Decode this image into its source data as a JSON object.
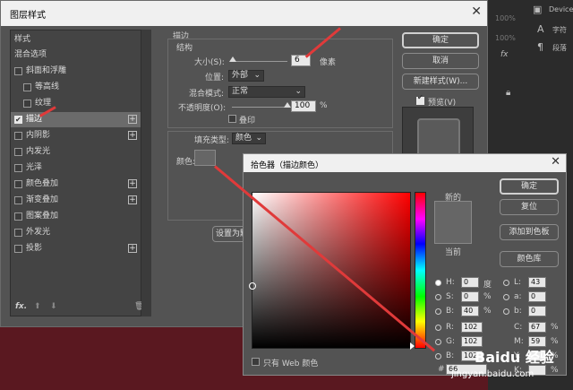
{
  "layer_style": {
    "title": "图层样式",
    "styles_header": "样式",
    "blend_options": "混合选项",
    "items": [
      {
        "label": "斜面和浮雕",
        "checked": false,
        "plus": false,
        "indent": false
      },
      {
        "label": "等高线",
        "checked": false,
        "plus": false,
        "indent": true
      },
      {
        "label": "纹理",
        "checked": false,
        "plus": false,
        "indent": true
      },
      {
        "label": "描边",
        "checked": true,
        "plus": true,
        "indent": false,
        "selected": true
      },
      {
        "label": "内阴影",
        "checked": false,
        "plus": true,
        "indent": false
      },
      {
        "label": "内发光",
        "checked": false,
        "plus": false,
        "indent": false
      },
      {
        "label": "光泽",
        "checked": false,
        "plus": false,
        "indent": false
      },
      {
        "label": "颜色叠加",
        "checked": false,
        "plus": true,
        "indent": false
      },
      {
        "label": "渐变叠加",
        "checked": false,
        "plus": true,
        "indent": false
      },
      {
        "label": "图案叠加",
        "checked": false,
        "plus": false,
        "indent": false
      },
      {
        "label": "外发光",
        "checked": false,
        "plus": false,
        "indent": false
      },
      {
        "label": "投影",
        "checked": false,
        "plus": true,
        "indent": false
      }
    ],
    "fx_label": "fx.",
    "stroke": {
      "section": "描边",
      "structure": "结构",
      "size_label": "大小(S):",
      "size_value": "6",
      "size_unit": "像素",
      "size_level": 0.02,
      "position_label": "位置:",
      "position_value": "外部",
      "blend_label": "混合模式:",
      "blend_value": "正常",
      "opacity_label": "不透明度(O):",
      "opacity_value": "100",
      "opacity_unit": "%",
      "opacity_level": 1.0,
      "overprint_label": "叠印",
      "fill_type_label": "填充类型:",
      "fill_type_value": "颜色",
      "color_label": "颜色:",
      "set_default": "设置为默"
    },
    "buttons": {
      "ok": "确定",
      "cancel": "取消",
      "new_style": "新建样式(W)...",
      "preview": "预览(V)"
    }
  },
  "color_picker": {
    "title": "拾色器（描边颜色）",
    "new_label": "新的",
    "current_label": "当前",
    "ok": "确定",
    "reset": "复位",
    "add_swatch": "添加到色板",
    "libraries": "颜色库",
    "web_only": "只有 Web 颜色",
    "hex_prefix": "#",
    "hex_value": "66",
    "new_color": "#666666",
    "fields": {
      "H": {
        "label": "H:",
        "value": "0",
        "unit": "度"
      },
      "S": {
        "label": "S:",
        "value": "0",
        "unit": "%"
      },
      "B": {
        "label": "B:",
        "value": "40",
        "unit": "%"
      },
      "R": {
        "label": "R:",
        "value": "102"
      },
      "G": {
        "label": "G:",
        "value": "102"
      },
      "Bl": {
        "label": "B:",
        "value": "102"
      },
      "L": {
        "label": "L:",
        "value": "43"
      },
      "a": {
        "label": "a:",
        "value": "0"
      },
      "b": {
        "label": "b:",
        "value": "0"
      },
      "C": {
        "label": "C:",
        "value": "67",
        "unit": "%"
      },
      "M": {
        "label": "M:",
        "value": "59",
        "unit": "%"
      },
      "Y": {
        "label": "Y:",
        "value": "",
        "unit": "%"
      },
      "K": {
        "label": "K:",
        "value": "",
        "unit": "%"
      }
    }
  },
  "ps_right": {
    "device": "Device",
    "char": "字符",
    "para": "段落",
    "zoom1": "100%",
    "zoom2": "100%"
  },
  "watermark": {
    "text": "Baidu 经验",
    "url": "jingyan.baidu.com"
  },
  "colors": {
    "arrow": "#e03a3a",
    "dialog_bg": "#535353",
    "accent_red": "#ff0000"
  }
}
